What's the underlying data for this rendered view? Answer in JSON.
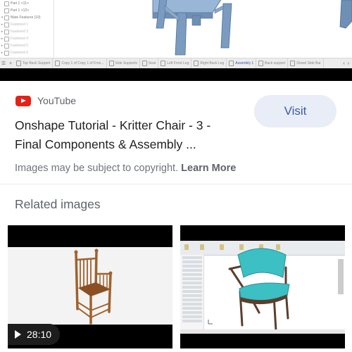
{
  "preview": {
    "feature_tree": [
      {
        "label": "Part 1 <11>",
        "expandable": false,
        "dim": false
      },
      {
        "label": "Part 1 <12>",
        "expandable": false,
        "dim": false
      },
      {
        "label": "Mate Features (10)",
        "expandable": true,
        "dim": false
      },
      {
        "label": "Fastened 1",
        "expandable": true,
        "dim": true
      },
      {
        "label": "Fastened 3",
        "expandable": true,
        "dim": true
      },
      {
        "label": "Fastened 4",
        "expandable": true,
        "dim": true
      },
      {
        "label": "Fastened 5",
        "expandable": true,
        "dim": true
      },
      {
        "label": "Fastened 6",
        "expandable": true,
        "dim": true
      }
    ],
    "tabs": [
      {
        "label": "Top Back Support",
        "active": false
      },
      {
        "label": "Copy 1 of Copy 1 of Fron...",
        "active": false
      },
      {
        "label": "Side Supports",
        "active": false
      },
      {
        "label": "Seat",
        "active": false
      },
      {
        "label": "Left Front Leg",
        "active": false
      },
      {
        "label": "Right Back Leg",
        "active": false
      },
      {
        "label": "Assembly 1",
        "active": true
      },
      {
        "label": "Back support",
        "active": false
      },
      {
        "label": "Dowel Side Bar",
        "active": false
      }
    ],
    "nav_prev": "‹",
    "nav_next": "›",
    "add_tab": "+",
    "menu_icon": "☰"
  },
  "result": {
    "source_name": "YouTube",
    "source_icon": "youtube-logo-icon",
    "title": "Onshape Tutorial - Kritter Chair - 3 - Final Components & Assembly ...",
    "visit_label": "Visit",
    "copyright_text": "Images may be subject to copyright.",
    "learn_more_label": "Learn More"
  },
  "related": {
    "heading": "Related images",
    "items": [
      {
        "kind": "video",
        "duration": "28:10",
        "subject": "wooden turned chair"
      },
      {
        "kind": "image",
        "subject": "teal upholstered chair in CAD software"
      }
    ]
  },
  "colors": {
    "youtube_red": "#e62117",
    "visit_bg": "#e8edf7",
    "visit_text": "#3b5aa8",
    "cad_chair": "#7b9cc0",
    "teal_chair": "#3cc0c4"
  }
}
